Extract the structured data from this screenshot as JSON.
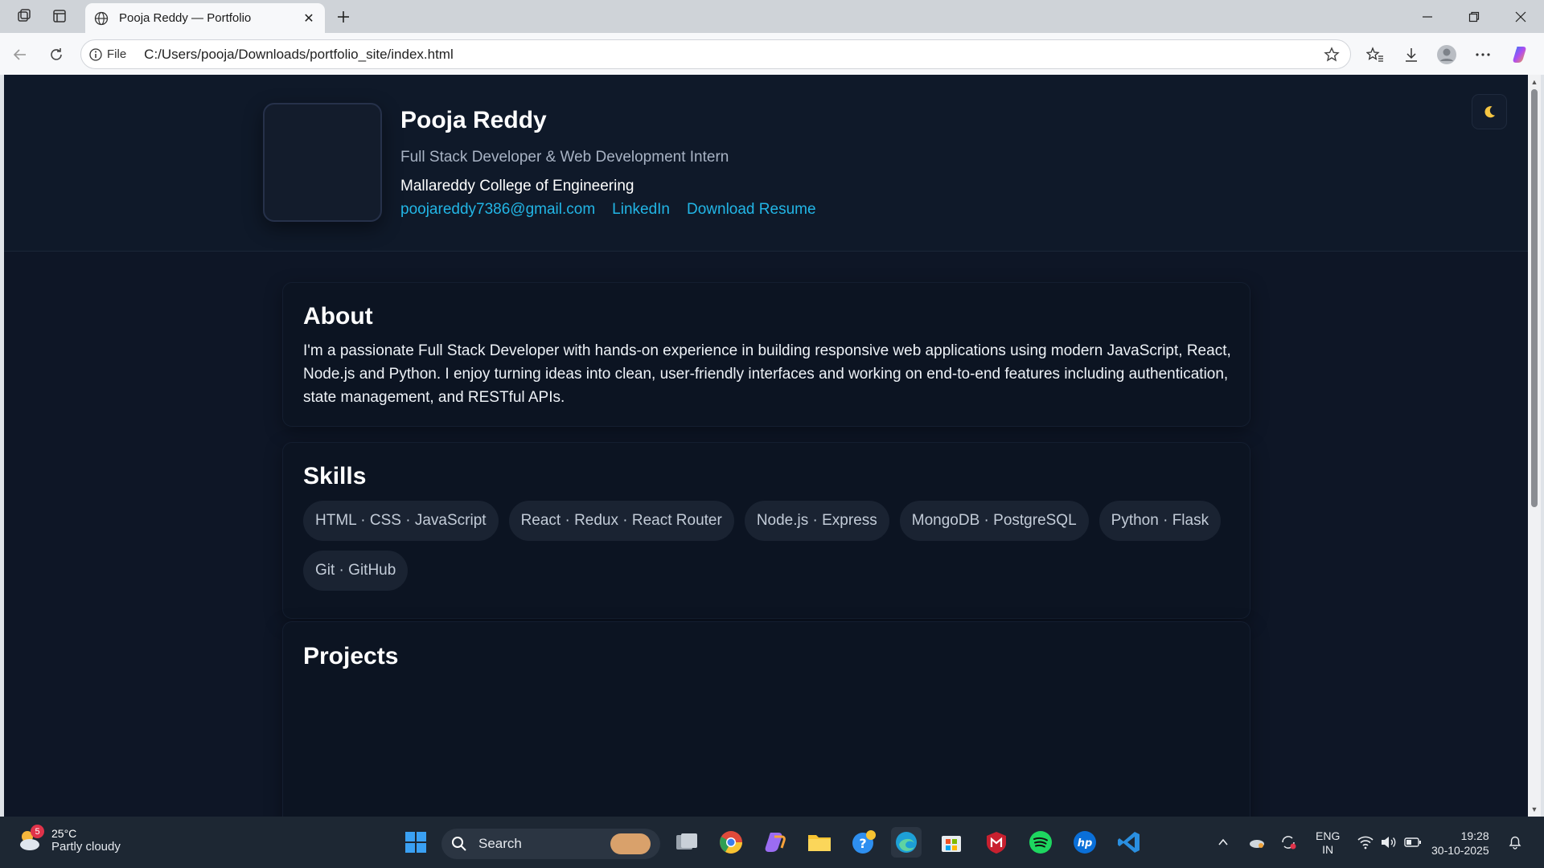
{
  "browser": {
    "tab_title": "Pooja Reddy — Portfolio",
    "address_scheme_label": "File",
    "address_url": "C:/Users/pooja/Downloads/portfolio_site/index.html"
  },
  "hero": {
    "name": "Pooja Reddy",
    "role": "Full Stack Developer & Web Development Intern",
    "college": "Mallareddy College of Engineering",
    "links": {
      "email": "poojareddy7386@gmail.com",
      "linkedin": "LinkedIn",
      "resume": "Download Resume"
    },
    "theme_toggle_icon": "moon-icon"
  },
  "about": {
    "heading": "About",
    "body": "I'm a passionate Full Stack Developer with hands-on experience in building responsive web applications using modern JavaScript, React, Node.js and Python. I enjoy turning ideas into clean, user-friendly interfaces and working on end-to-end features including authentication, state management, and RESTful APIs."
  },
  "skills": {
    "heading": "Skills",
    "items": [
      "HTML · CSS · JavaScript",
      "React · Redux · React Router",
      "Node.js · Express",
      "MongoDB · PostgreSQL",
      "Python · Flask",
      "Git · GitHub"
    ]
  },
  "projects": {
    "heading": "Projects"
  },
  "taskbar": {
    "weather_temp": "25°C",
    "weather_condition": "Partly cloudy",
    "weather_badge": "5",
    "search_label": "Search",
    "lang_line1": "ENG",
    "lang_line2": "IN",
    "time": "19:28",
    "date": "30-10-2025"
  },
  "colors": {
    "page_bg": "#0e1626",
    "accent_link": "#22b6e6",
    "chip_bg": "#1a2332"
  }
}
